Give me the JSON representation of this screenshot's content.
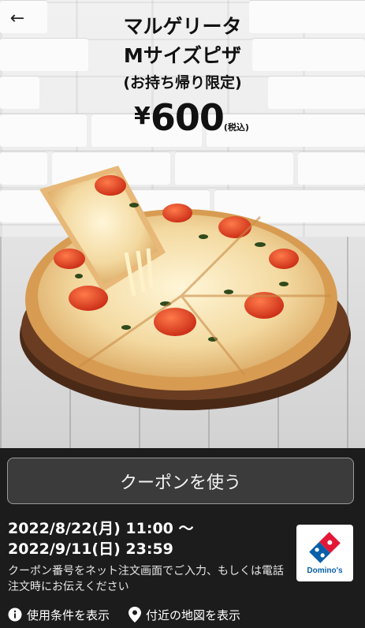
{
  "header": {
    "back_icon": "arrow-left-icon",
    "title_line1": "マルゲリータ",
    "title_line2": "Mサイズピザ",
    "title_line3": "(お持ち帰り限定)",
    "price_symbol": "¥",
    "price_value": "600",
    "price_tax": "(税込)"
  },
  "coupon": {
    "use_button_label": "クーポンを使う",
    "period_start": "2022/8/22(月) 11:00 〜",
    "period_end": "2022/9/11(日) 23:59",
    "instructions": "クーポン番号をネット注文画面でご入力、もしくは電話注文時にお伝えください",
    "brand_logo_text": "Domino's"
  },
  "links": {
    "terms_label": "使用条件を表示",
    "terms_icon": "info-icon",
    "map_label": "付近の地図を表示",
    "map_icon": "map-pin-icon"
  },
  "colors": {
    "background": "#1c1c1c",
    "button_bg": "#3b3b3b",
    "domino_blue": "#0a5fa8",
    "domino_red": "#e31837"
  }
}
